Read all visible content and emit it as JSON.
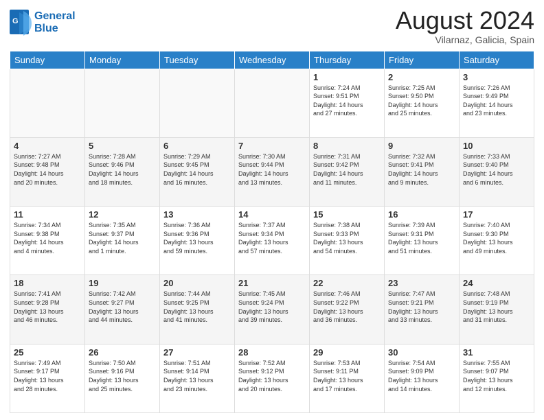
{
  "logo": {
    "line1": "General",
    "line2": "Blue"
  },
  "title": "August 2024",
  "subtitle": "Vilarnaz, Galicia, Spain",
  "days_of_week": [
    "Sunday",
    "Monday",
    "Tuesday",
    "Wednesday",
    "Thursday",
    "Friday",
    "Saturday"
  ],
  "weeks": [
    [
      {
        "day": "",
        "info": ""
      },
      {
        "day": "",
        "info": ""
      },
      {
        "day": "",
        "info": ""
      },
      {
        "day": "",
        "info": ""
      },
      {
        "day": "1",
        "info": "Sunrise: 7:24 AM\nSunset: 9:51 PM\nDaylight: 14 hours\nand 27 minutes."
      },
      {
        "day": "2",
        "info": "Sunrise: 7:25 AM\nSunset: 9:50 PM\nDaylight: 14 hours\nand 25 minutes."
      },
      {
        "day": "3",
        "info": "Sunrise: 7:26 AM\nSunset: 9:49 PM\nDaylight: 14 hours\nand 23 minutes."
      }
    ],
    [
      {
        "day": "4",
        "info": "Sunrise: 7:27 AM\nSunset: 9:48 PM\nDaylight: 14 hours\nand 20 minutes."
      },
      {
        "day": "5",
        "info": "Sunrise: 7:28 AM\nSunset: 9:46 PM\nDaylight: 14 hours\nand 18 minutes."
      },
      {
        "day": "6",
        "info": "Sunrise: 7:29 AM\nSunset: 9:45 PM\nDaylight: 14 hours\nand 16 minutes."
      },
      {
        "day": "7",
        "info": "Sunrise: 7:30 AM\nSunset: 9:44 PM\nDaylight: 14 hours\nand 13 minutes."
      },
      {
        "day": "8",
        "info": "Sunrise: 7:31 AM\nSunset: 9:42 PM\nDaylight: 14 hours\nand 11 minutes."
      },
      {
        "day": "9",
        "info": "Sunrise: 7:32 AM\nSunset: 9:41 PM\nDaylight: 14 hours\nand 9 minutes."
      },
      {
        "day": "10",
        "info": "Sunrise: 7:33 AM\nSunset: 9:40 PM\nDaylight: 14 hours\nand 6 minutes."
      }
    ],
    [
      {
        "day": "11",
        "info": "Sunrise: 7:34 AM\nSunset: 9:38 PM\nDaylight: 14 hours\nand 4 minutes."
      },
      {
        "day": "12",
        "info": "Sunrise: 7:35 AM\nSunset: 9:37 PM\nDaylight: 14 hours\nand 1 minute."
      },
      {
        "day": "13",
        "info": "Sunrise: 7:36 AM\nSunset: 9:36 PM\nDaylight: 13 hours\nand 59 minutes."
      },
      {
        "day": "14",
        "info": "Sunrise: 7:37 AM\nSunset: 9:34 PM\nDaylight: 13 hours\nand 57 minutes."
      },
      {
        "day": "15",
        "info": "Sunrise: 7:38 AM\nSunset: 9:33 PM\nDaylight: 13 hours\nand 54 minutes."
      },
      {
        "day": "16",
        "info": "Sunrise: 7:39 AM\nSunset: 9:31 PM\nDaylight: 13 hours\nand 51 minutes."
      },
      {
        "day": "17",
        "info": "Sunrise: 7:40 AM\nSunset: 9:30 PM\nDaylight: 13 hours\nand 49 minutes."
      }
    ],
    [
      {
        "day": "18",
        "info": "Sunrise: 7:41 AM\nSunset: 9:28 PM\nDaylight: 13 hours\nand 46 minutes."
      },
      {
        "day": "19",
        "info": "Sunrise: 7:42 AM\nSunset: 9:27 PM\nDaylight: 13 hours\nand 44 minutes."
      },
      {
        "day": "20",
        "info": "Sunrise: 7:44 AM\nSunset: 9:25 PM\nDaylight: 13 hours\nand 41 minutes."
      },
      {
        "day": "21",
        "info": "Sunrise: 7:45 AM\nSunset: 9:24 PM\nDaylight: 13 hours\nand 39 minutes."
      },
      {
        "day": "22",
        "info": "Sunrise: 7:46 AM\nSunset: 9:22 PM\nDaylight: 13 hours\nand 36 minutes."
      },
      {
        "day": "23",
        "info": "Sunrise: 7:47 AM\nSunset: 9:21 PM\nDaylight: 13 hours\nand 33 minutes."
      },
      {
        "day": "24",
        "info": "Sunrise: 7:48 AM\nSunset: 9:19 PM\nDaylight: 13 hours\nand 31 minutes."
      }
    ],
    [
      {
        "day": "25",
        "info": "Sunrise: 7:49 AM\nSunset: 9:17 PM\nDaylight: 13 hours\nand 28 minutes."
      },
      {
        "day": "26",
        "info": "Sunrise: 7:50 AM\nSunset: 9:16 PM\nDaylight: 13 hours\nand 25 minutes."
      },
      {
        "day": "27",
        "info": "Sunrise: 7:51 AM\nSunset: 9:14 PM\nDaylight: 13 hours\nand 23 minutes."
      },
      {
        "day": "28",
        "info": "Sunrise: 7:52 AM\nSunset: 9:12 PM\nDaylight: 13 hours\nand 20 minutes."
      },
      {
        "day": "29",
        "info": "Sunrise: 7:53 AM\nSunset: 9:11 PM\nDaylight: 13 hours\nand 17 minutes."
      },
      {
        "day": "30",
        "info": "Sunrise: 7:54 AM\nSunset: 9:09 PM\nDaylight: 13 hours\nand 14 minutes."
      },
      {
        "day": "31",
        "info": "Sunrise: 7:55 AM\nSunset: 9:07 PM\nDaylight: 13 hours\nand 12 minutes."
      }
    ]
  ]
}
